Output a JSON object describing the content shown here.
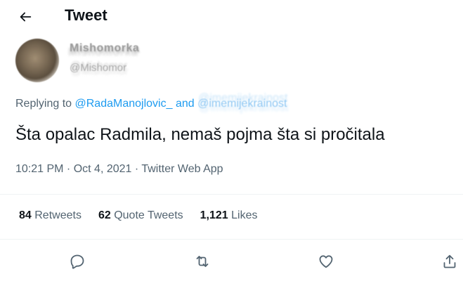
{
  "header": {
    "title": "Tweet"
  },
  "author": {
    "name": "Mishomorka",
    "handle": "@Mishomor"
  },
  "replying": {
    "prefix": "Replying to",
    "user1": "@RadaManojlovic_",
    "conjunction": "and",
    "user2": "@imemijekrainost"
  },
  "tweet": {
    "text": "Šta opalac Radmila, nemaš pojma šta si pročitala",
    "time": "10:21 PM",
    "separator1": " · ",
    "date": "Oct 4, 2021",
    "separator2": " · ",
    "source": "Twitter Web App"
  },
  "stats": {
    "retweets_count": "84",
    "retweets_label": "Retweets",
    "quotes_count": "62",
    "quotes_label": "Quote Tweets",
    "likes_count": "1,121",
    "likes_label": "Likes"
  },
  "icons": {
    "back": "arrow-left-icon",
    "reply": "reply-icon",
    "retweet": "retweet-icon",
    "like": "heart-icon",
    "share": "share-icon"
  },
  "colors": {
    "text": "#0f1419",
    "secondary": "#536471",
    "link": "#1d9bf0",
    "divider": "#eff3f4"
  }
}
